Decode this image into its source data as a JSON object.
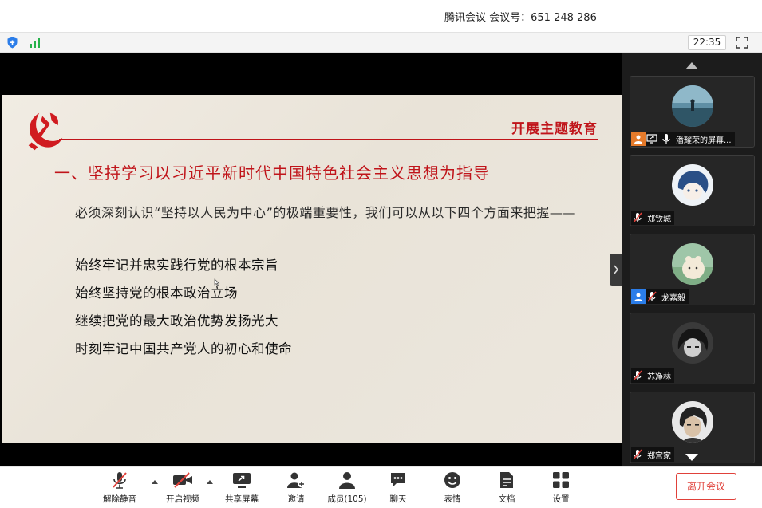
{
  "window": {
    "title": "腾讯会议 会议号：651 248 286",
    "time": "22:35"
  },
  "slide": {
    "header": "开展主题教育",
    "heading": "一、坚持学习以习近平新时代中国特色社会主义思想为指导",
    "intro": "必须深刻认识“坚持以人民为中心”的极端重要性，我们可以从以下四个方面来把握——",
    "points": [
      "始终牢记并忠实践行党的根本宗旨",
      "始终坚持党的根本政治立场",
      "继续把党的最大政治优势发扬光大",
      "时刻牢记中国共产党人的初心和使命"
    ]
  },
  "participants": [
    {
      "name": "潘耀荣的屏幕...",
      "status": "screen-sharing"
    },
    {
      "name": "郑钦城",
      "status": "muted"
    },
    {
      "name": "龙嘉毅",
      "status": "muted"
    },
    {
      "name": "苏净林",
      "status": "muted"
    },
    {
      "name": "郑宫家",
      "status": "muted"
    }
  ],
  "toolbar": {
    "unmute": "解除静音",
    "video": "开启视频",
    "share": "共享屏幕",
    "invite": "邀请",
    "members": "成员(105)",
    "chat": "聊天",
    "reactions": "表情",
    "docs": "文档",
    "settings": "设置",
    "leave": "离开会议"
  },
  "colors": {
    "accent_red": "#c0141a",
    "leave_red": "#e0413a",
    "panel_bg": "#1c1c1c"
  }
}
